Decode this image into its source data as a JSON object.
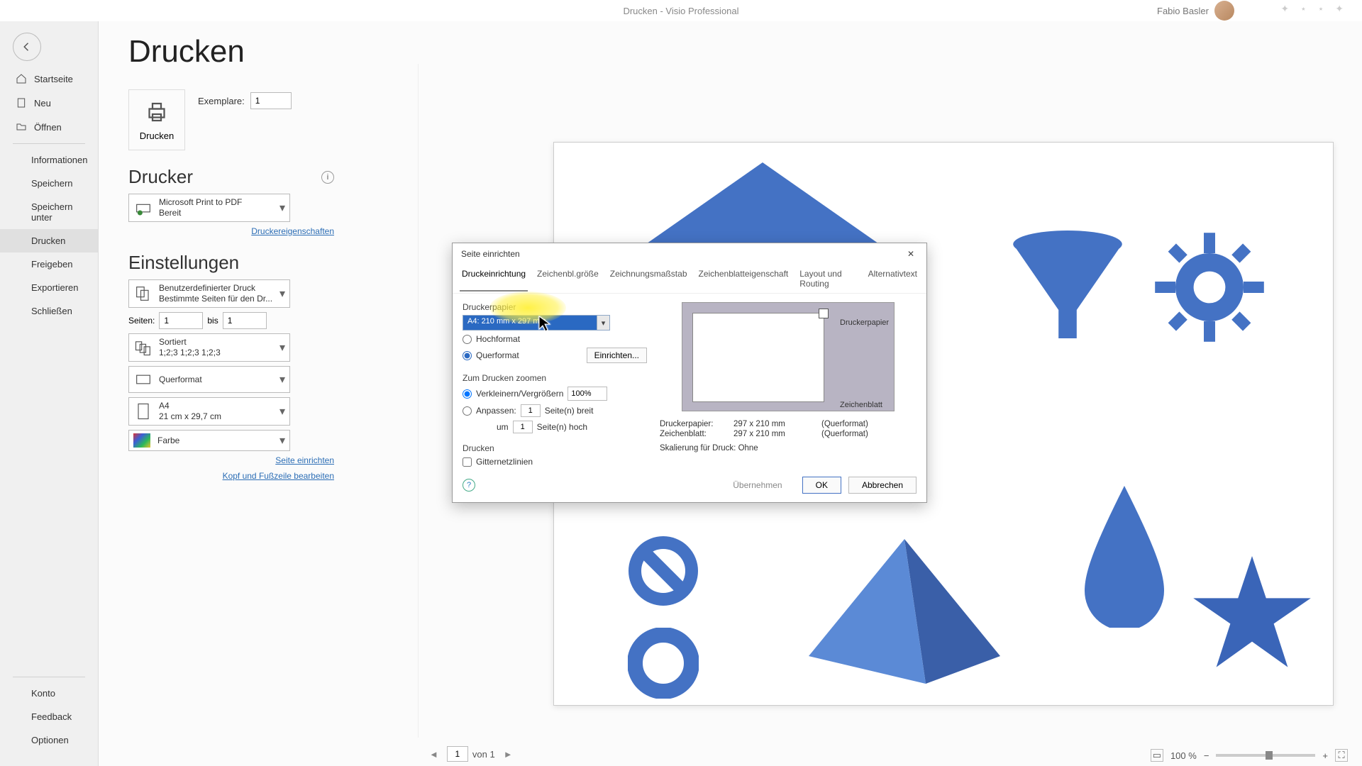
{
  "titlebar": {
    "title": "Drucken  -  Visio Professional",
    "user": "Fabio Basler"
  },
  "back": "←",
  "sidebar": {
    "home": "Startseite",
    "new": "Neu",
    "open": "Öffnen",
    "info": "Informationen",
    "save": "Speichern",
    "save_as": "Speichern unter",
    "print": "Drucken",
    "share": "Freigeben",
    "export": "Exportieren",
    "close": "Schließen",
    "account": "Konto",
    "feedback": "Feedback",
    "options": "Optionen"
  },
  "main": {
    "title": "Drucken",
    "print_btn": "Drucken",
    "copies_label": "Exemplare:",
    "copies_value": "1",
    "printer_section": "Drucker",
    "printer_name": "Microsoft Print to PDF",
    "printer_status": "Bereit",
    "printer_props": "Druckereigenschaften",
    "settings_section": "Einstellungen",
    "custom_print": "Benutzerdefinierter Druck",
    "custom_print_sub": "Bestimmte Seiten für den Dr...",
    "pages_label": "Seiten:",
    "pages_from": "1",
    "pages_to_label": "bis",
    "pages_to": "1",
    "collate_title": "Sortiert",
    "collate_sub": "1;2;3    1;2;3    1;2;3",
    "orientation": "Querformat",
    "paper_name": "A4",
    "paper_dim": "21 cm x 29,7 cm",
    "color": "Farbe",
    "page_setup_link": "Seite einrichten",
    "header_footer_link": "Kopf und Fußzeile bearbeiten"
  },
  "footer": {
    "cur_page": "1",
    "page_count": "von 1",
    "zoom": "100 %"
  },
  "dialog": {
    "title": "Seite einrichten",
    "tabs": {
      "t1": "Druckeinrichtung",
      "t2": "Zeichenbl.größe",
      "t3": "Zeichnungsmaßstab",
      "t4": "Zeichenblatteigenschaft",
      "t5": "Layout und Routing",
      "t6": "Alternativtext"
    },
    "paper_group": "Druckerpapier",
    "paper_sel": "A4:  210 mm x 297 mm",
    "portrait": "Hochformat",
    "landscape": "Querformat",
    "setup": "Einrichten...",
    "zoom_group": "Zum Drucken zoomen",
    "shrink": "Verkleinern/Vergrößern",
    "pct": "100%",
    "fit": "Anpassen:",
    "fit_w": "1",
    "fit_w_lbl": "Seite(n) breit",
    "fit_h_lbl_pre": "um",
    "fit_h": "1",
    "fit_h_lbl": "Seite(n) hoch",
    "print_group": "Drucken",
    "gridlines": "Gitternetzlinien",
    "mini_lbl_printer": "Druckerpapier",
    "mini_lbl_sheet": "Zeichenblatt",
    "info_k1": "Druckerpapier:",
    "info_v1": "297 x 210 mm",
    "info_o1": "(Querformat)",
    "info_k2": "Zeichenblatt:",
    "info_v2": "297 x 210 mm",
    "info_o2": "(Querformat)",
    "info_scale": "Skalierung für Druck: Ohne",
    "apply": "Übernehmen",
    "ok": "OK",
    "cancel": "Abbrechen"
  }
}
